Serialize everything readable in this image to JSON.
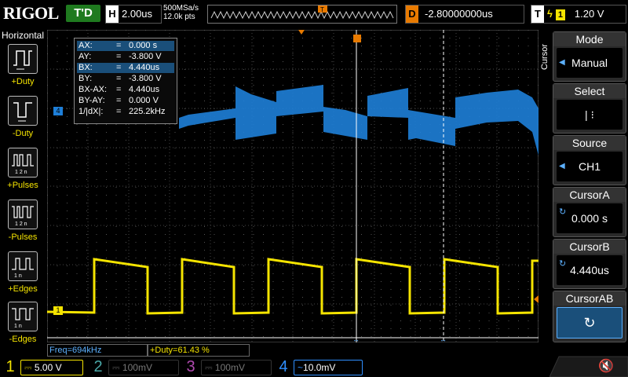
{
  "header": {
    "logo": "RIGOL",
    "trigger_status": "T'D",
    "h_label": "H",
    "timebase": "2.00us",
    "sample_rate": "500MSa/s",
    "memory_depth": "12.0k pts",
    "memory_marker": "T",
    "d_label": "D",
    "delay": "-2.80000000us",
    "t_label": "T",
    "trigger_source": "1",
    "trigger_level": "1.20 V"
  },
  "left_menu": {
    "title": "Horizontal",
    "items": [
      {
        "label": "+Duty",
        "icon": "positive-duty-icon"
      },
      {
        "label": "-Duty",
        "icon": "negative-duty-icon"
      },
      {
        "label": "+Pulses",
        "icon": "positive-pulses-icon"
      },
      {
        "label": "-Pulses",
        "icon": "negative-pulses-icon"
      },
      {
        "label": "+Edges",
        "icon": "rising-edges-icon"
      },
      {
        "label": "-Edges",
        "icon": "falling-edges-icon"
      }
    ]
  },
  "cursor_readout": {
    "rows": [
      {
        "key": "AX:",
        "eq": "=",
        "val": "0.000 s",
        "highlight": true
      },
      {
        "key": "AY:",
        "eq": "=",
        "val": "-3.800 V",
        "highlight": false
      },
      {
        "key": "BX:",
        "eq": "=",
        "val": "4.440us",
        "highlight": true
      },
      {
        "key": "BY:",
        "eq": "=",
        "val": "-3.800 V",
        "highlight": false
      },
      {
        "key": "BX-AX:",
        "eq": "=",
        "val": "4.440us",
        "highlight": false
      },
      {
        "key": "BY-AY:",
        "eq": "=",
        "val": "0.000 V",
        "highlight": false
      },
      {
        "key": "1/|dX|:",
        "eq": "=",
        "val": "225.2kHz",
        "highlight": false
      }
    ]
  },
  "channel_markers": {
    "ch4": "4",
    "ch1": "1"
  },
  "right_menu": {
    "vertical_label": "Cursor",
    "mode_title": "Mode",
    "mode_value": "Manual",
    "select_title": "Select",
    "select_value": "| ⁝",
    "source_title": "Source",
    "source_value": "CH1",
    "cursora_title": "CursorA",
    "cursora_value": "0.000 s",
    "cursorb_title": "CursorB",
    "cursorb_value": "4.440us",
    "cursorab_title": "CursorAB",
    "cursorab_value": "↻"
  },
  "measurements": {
    "freq": "Freq=694kHz",
    "duty": "+Duty=61.43 %"
  },
  "channels": [
    {
      "num": "1",
      "scale": "5.00 V",
      "color": "#f5e400",
      "active": true
    },
    {
      "num": "2",
      "scale": "100mV",
      "color": "#4aa8a8",
      "active": false
    },
    {
      "num": "3",
      "scale": "100mV",
      "color": "#b04ab0",
      "active": false
    },
    {
      "num": "4",
      "scale": "10.0mV",
      "color": "#2f8fff",
      "active": true
    }
  ],
  "colors": {
    "ch1": "#f5e400",
    "ch4": "#1e8fff",
    "accent_orange": "#e87a00",
    "trig_green": "#1f7a1f"
  }
}
